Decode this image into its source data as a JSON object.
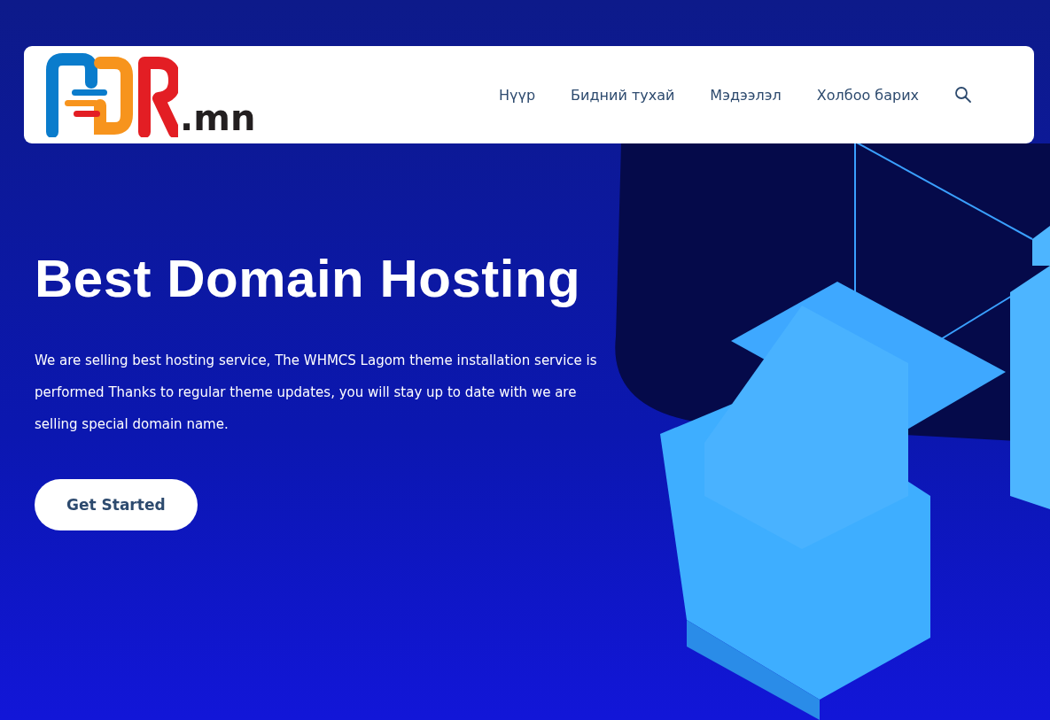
{
  "header": {
    "logo_suffix": ".mn",
    "nav": [
      {
        "label": "Нүүр"
      },
      {
        "label": "Бидний тухай"
      },
      {
        "label": "Мэдээлэл"
      },
      {
        "label": "Холбоо барих"
      }
    ]
  },
  "hero": {
    "title": "Best Domain Hosting",
    "text": "We are selling best hosting service, The WHMCS Lagom theme installation service is performed Thanks to regular theme updates, you will stay up to date with we are selling special domain name.",
    "button": "Get Started"
  }
}
